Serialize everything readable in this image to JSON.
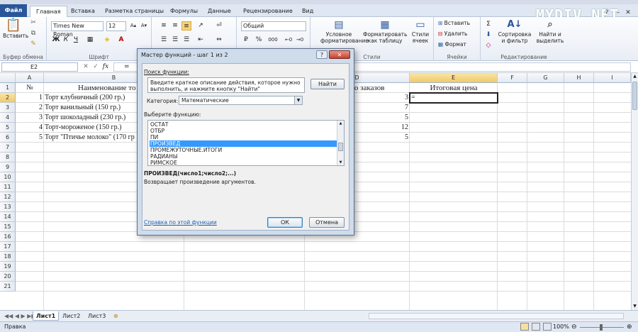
{
  "watermark": "MYDIV.NET",
  "tabs": [
    "Файл",
    "Главная",
    "Вставка",
    "Разметка страницы",
    "Формулы",
    "Данные",
    "Рецензирование",
    "Вид"
  ],
  "ribbon": {
    "paste": "Вставить",
    "clipboard_group": "Буфер обмена",
    "font_name": "Times New Roman",
    "font_size": "12",
    "font_group": "Шрифт",
    "number_format": "Общий",
    "percent": "%",
    "thousands": "000",
    "cond_format": [
      "Условное",
      "форматирование"
    ],
    "format_table": [
      "Форматировать",
      "как таблицу"
    ],
    "cell_styles": [
      "Стили",
      "ячеек"
    ],
    "styles_group": "Стили",
    "insert": "Вставить",
    "delete": "Удалить",
    "format": "Формат",
    "cells_group": "Ячейки",
    "sort": [
      "Сортировка",
      "и фильтр"
    ],
    "find": [
      "Найти и",
      "выделить"
    ],
    "editing_group": "Редактирование"
  },
  "formula_bar": {
    "name_box": "E2",
    "formula": "="
  },
  "columns": [
    "A",
    "B",
    "C",
    "D",
    "E",
    "F",
    "G",
    "H",
    "I"
  ],
  "rows": [
    "1",
    "2",
    "3",
    "4",
    "5",
    "6",
    "7",
    "8",
    "9",
    "10",
    "11",
    "12",
    "13",
    "14",
    "15",
    "16",
    "17",
    "18",
    "19",
    "20",
    "21"
  ],
  "cells": {
    "a1": "№",
    "b1": "Наименование то",
    "d1": "тво заказов",
    "e1": "Итоговая цена",
    "a2": "1",
    "b2": "Торт клубничный (200 гр.)",
    "d2": "3",
    "e2": "=",
    "a3": "2",
    "b3": "Торт ванильный (150 гр.)",
    "d3": "7",
    "a4": "3",
    "b4": "Торт шоколадный (230 гр.)",
    "d4": "5",
    "a5": "4",
    "b5": "Торт-мороженое (150 гр.)",
    "d5": "12",
    "a6": "5",
    "b6": "Торт \"Птичье молоко\" (170 гр",
    "d6": "5"
  },
  "sheets": [
    "Лист1",
    "Лист2",
    "Лист3"
  ],
  "status": {
    "ready": "Правка",
    "zoom": "100%"
  },
  "dialog": {
    "title": "Мастер функций - шаг 1 из 2",
    "search_label": "Поиск функции:",
    "search_text": "Введите краткое описание действия, которое нужно выполнить, и нажмите кнопку \"Найти\"",
    "find_button": "Найти",
    "category_label": "Категория:",
    "category_value": "Математические",
    "select_label": "Выберите функцию:",
    "functions": [
      "ОСТАТ",
      "ОТБР",
      "ПИ",
      "ПРОИЗВЕД",
      "ПРОМЕЖУТОЧНЫЕ.ИТОГИ",
      "РАДИАНЫ",
      "РИМСКОЕ"
    ],
    "selected_function": "ПРОИЗВЕД",
    "signature": "ПРОИЗВЕД(число1;число2;...)",
    "description": "Возвращает произведение аргументов.",
    "help_link": "Справка по этой функции",
    "ok": "ОК",
    "cancel": "Отмена"
  }
}
